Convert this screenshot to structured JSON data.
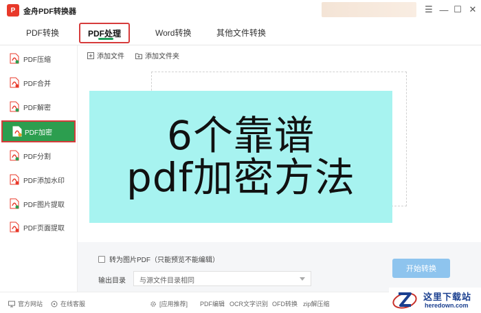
{
  "app": {
    "logo_text": "P",
    "title": "金舟PDF转换器",
    "controls": [
      "☰",
      "—",
      "☐",
      "✕"
    ]
  },
  "tabs": [
    {
      "label": "PDF转换",
      "active": false
    },
    {
      "label": "PDF处理",
      "active": true
    },
    {
      "label": "Word转换",
      "active": false
    },
    {
      "label": "其他文件转换",
      "active": false
    }
  ],
  "sidebar": {
    "items": [
      {
        "label": "PDF压缩",
        "active": false
      },
      {
        "label": "PDF合并",
        "active": false
      },
      {
        "label": "PDF解密",
        "active": false
      },
      {
        "label": "PDF加密",
        "active": true
      },
      {
        "label": "PDF分割",
        "active": false
      },
      {
        "label": "PDF添加水印",
        "active": false
      },
      {
        "label": "PDF图片提取",
        "active": false
      },
      {
        "label": "PDF页面提取",
        "active": false
      }
    ]
  },
  "toolbar": {
    "add_file": "添加文件",
    "add_folder": "添加文件夹"
  },
  "overlay": {
    "line1": "6个靠谱",
    "line2": "pdf加密方法",
    "bg_color": "#a7f3f0"
  },
  "options": {
    "convert_to_image_label": "转为图片PDF（只能预览不能编辑）",
    "output_dir_label": "输出目录",
    "output_dir_value": "与源文件目录相同",
    "start_button": "开始转换"
  },
  "footer": {
    "website": "官方网站",
    "support": "在线客服",
    "recommend": "[应用推荐]",
    "links": [
      "PDF编辑",
      "OCR文字识别",
      "OFD转换",
      "zip解压缩"
    ]
  },
  "watermark": {
    "cn": "这里下载站",
    "en": "heredown.com"
  },
  "colors": {
    "accent_green": "#2c9e4f",
    "highlight_red": "#d63b3b",
    "start_button": "#8ec4ee",
    "logo_red": "#e8392a"
  }
}
